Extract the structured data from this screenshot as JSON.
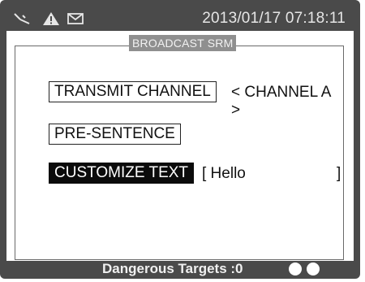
{
  "status_bar": {
    "icons": [
      "satellite-icon",
      "warning-icon",
      "mail-icon"
    ],
    "datetime": "2013/01/17 07:18:11"
  },
  "panel": {
    "title": "BROADCAST SRM",
    "items": [
      {
        "label": "TRANSMIT CHANNEL",
        "value": "< CHANNEL A >",
        "selected": false
      },
      {
        "label": "PRE-SENTENCE",
        "value": "",
        "selected": false
      },
      {
        "label": "CUSTOMIZE TEXT",
        "value_open": "[ Hello",
        "value_close": "]",
        "selected": true
      }
    ]
  },
  "footer": {
    "text": "Dangerous Targets :0",
    "indicators": 2
  }
}
